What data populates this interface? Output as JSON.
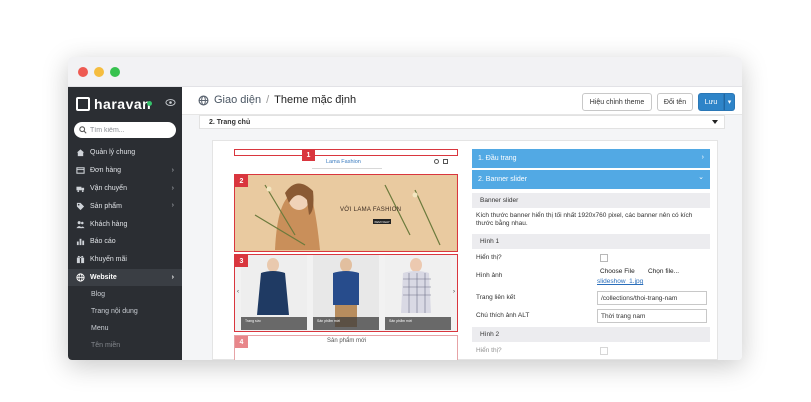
{
  "window": {
    "controls": [
      {
        "name": "close",
        "color": "#ee5a52"
      },
      {
        "name": "minimize",
        "color": "#f5bd3f"
      },
      {
        "name": "maximize",
        "color": "#38c24f"
      }
    ]
  },
  "sidebar": {
    "logo_text": "haravan",
    "search_placeholder": "Tìm kiếm...",
    "items": [
      {
        "label": "Quản lý chung",
        "icon": "home-icon",
        "chevron": ""
      },
      {
        "label": "Đơn hàng",
        "icon": "orders-icon",
        "chevron": "›"
      },
      {
        "label": "Vận chuyển",
        "icon": "truck-icon",
        "chevron": "›"
      },
      {
        "label": "Sản phẩm",
        "icon": "tag-icon",
        "chevron": "›"
      },
      {
        "label": "Khách hàng",
        "icon": "users-icon",
        "chevron": ""
      },
      {
        "label": "Báo cáo",
        "icon": "bar-chart-icon",
        "chevron": ""
      },
      {
        "label": "Khuyến mãi",
        "icon": "promo-icon",
        "chevron": ""
      },
      {
        "label": "Website",
        "icon": "globe-icon",
        "chevron": "›"
      }
    ],
    "sub_items": [
      "Blog",
      "Trang nội dung",
      "Menu",
      "Tên miền"
    ]
  },
  "topbar": {
    "crumb_parent": "Giao diện",
    "crumb_sep": "/",
    "crumb_current": "Theme mặc định",
    "btn_edit": "Hiệu chỉnh theme",
    "btn_rename": "Đổi tên",
    "btn_save": "Lưu",
    "btn_save_caret": "▾"
  },
  "section": {
    "title": "2. Trang chủ"
  },
  "preview": {
    "shop_name": "Lama Fashion",
    "slider_text": "VỚI LAMA FASHION",
    "slider_button": "XEM NGAY",
    "badges": [
      "1",
      "2",
      "3",
      "4"
    ],
    "product_section": "Sản phẩm mới",
    "product_labels": [
      "Trang sức",
      "Sản phẩm mới",
      "Sản phẩm mới"
    ]
  },
  "settings": {
    "accordion": [
      {
        "label": "1. Đầu trang",
        "chevron": "›"
      },
      {
        "label": "2. Banner slider",
        "chevron": "⌄"
      }
    ],
    "sub_title": "Banner slider",
    "description": "Kích thước banner hiển thị tối nhất 1920x760 pixel, các banner nên có kích thước bằng nhau.",
    "image1": {
      "heading": "Hình 1",
      "show_label": "Hiển thị?",
      "image_label": "Hình ảnh",
      "choose_file": "Choose File",
      "choose_text": "Chọn file...",
      "file_name": "slideshow_1.jpg",
      "link_label": "Trang liên kết",
      "link_value": "/collections/thoi-trang-nam",
      "alt_label": "Chú thích ảnh ALT",
      "alt_value": "Thời trang nam"
    },
    "image2": {
      "heading": "Hình 2",
      "show_label": "Hiển thị?"
    }
  }
}
